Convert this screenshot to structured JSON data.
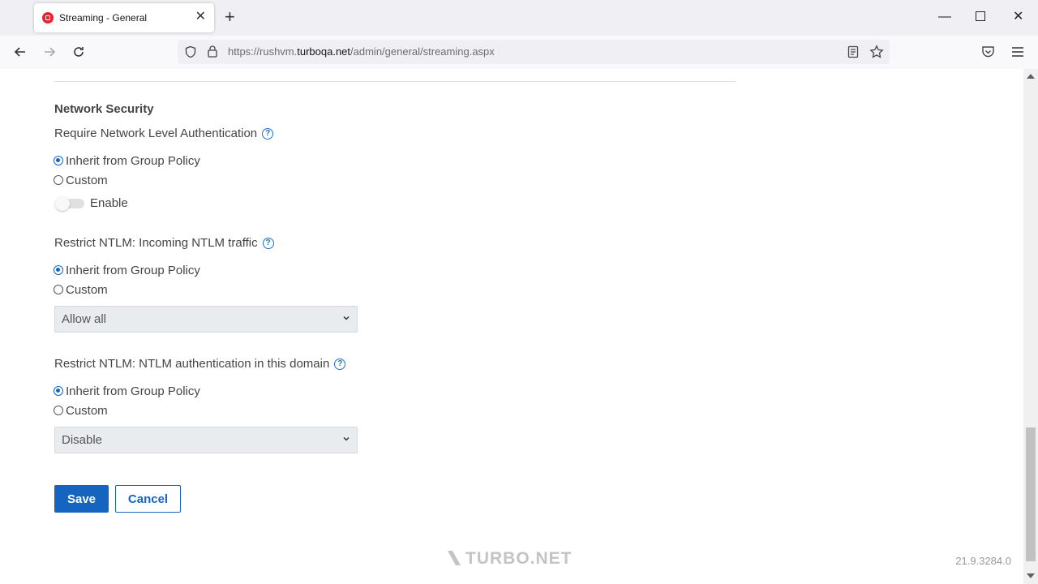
{
  "browser": {
    "tab_title": "Streaming - General",
    "url_prefix": "https://rushvm.",
    "url_domain": "turboqa.net",
    "url_path": "/admin/general/streaming.aspx"
  },
  "section": {
    "title": "Network Security"
  },
  "nla": {
    "label": "Require Network Level Authentication",
    "options": [
      "Inherit from Group Policy",
      "Custom"
    ],
    "selected": "Inherit from Group Policy",
    "toggle_label": "Enable",
    "toggle_on": false
  },
  "incoming_ntlm": {
    "label": "Restrict NTLM: Incoming NTLM traffic",
    "options": [
      "Inherit from Group Policy",
      "Custom"
    ],
    "selected": "Inherit from Group Policy",
    "select_value": "Allow all"
  },
  "domain_ntlm": {
    "label": "Restrict NTLM: NTLM authentication in this domain",
    "options": [
      "Inherit from Group Policy",
      "Custom"
    ],
    "selected": "Inherit from Group Policy",
    "select_value": "Disable"
  },
  "actions": {
    "save_label": "Save",
    "cancel_label": "Cancel"
  },
  "footer": {
    "brand": "TURBO.NET",
    "version": "21.9.3284.0"
  },
  "colors": {
    "primary": "#1565c0",
    "help": "#1a73c8"
  }
}
